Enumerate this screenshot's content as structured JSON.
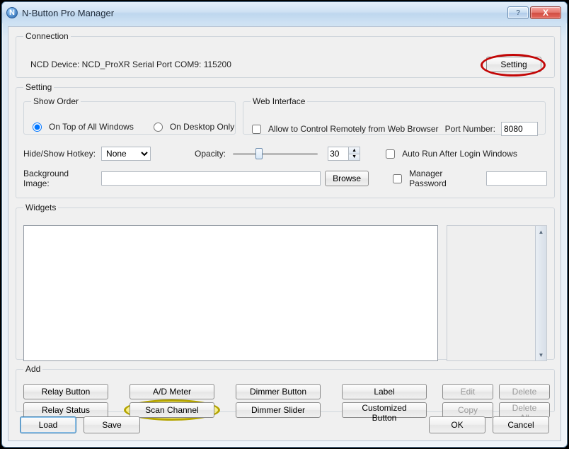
{
  "title": "N-Button Pro Manager",
  "sys": {
    "help": "?",
    "close": "X"
  },
  "connection": {
    "legend": "Connection",
    "device_text": "NCD Device: NCD_ProXR  Serial Port  COM9: 115200",
    "setting_btn": "Setting"
  },
  "setting": {
    "legend": "Setting",
    "show_order": {
      "legend": "Show Order",
      "on_top": "On Top of All Windows",
      "desktop": "On Desktop Only"
    },
    "web": {
      "legend": "Web Interface",
      "allow": "Allow to Control Remotely from Web Browser",
      "port_label": "Port Number:",
      "port_value": "8080"
    },
    "hotkey_label": "Hide/Show Hotkey:",
    "hotkey_value": "None",
    "opacity_label": "Opacity:",
    "opacity_value": "30",
    "autorun": "Auto Run After Login Windows",
    "bgimg_label": "Background Image:",
    "bgimg_value": "",
    "browse": "Browse",
    "mgrpwd": "Manager Password",
    "mgrpwd_value": ""
  },
  "widgets": {
    "legend": "Widgets"
  },
  "add": {
    "legend": "Add",
    "relay_button": "Relay Button",
    "ad_meter": "A/D Meter",
    "dimmer_button": "Dimmer Button",
    "label": "Label",
    "relay_status": "Relay Status",
    "scan_channel": "Scan Channel",
    "dimmer_slider": "Dimmer Slider",
    "customized": "Customized Button",
    "edit": "Edit",
    "delete": "Delete",
    "copy": "Copy",
    "delete_all": "Delete All"
  },
  "bottom": {
    "load": "Load",
    "save": "Save",
    "ok": "OK",
    "cancel": "Cancel"
  }
}
